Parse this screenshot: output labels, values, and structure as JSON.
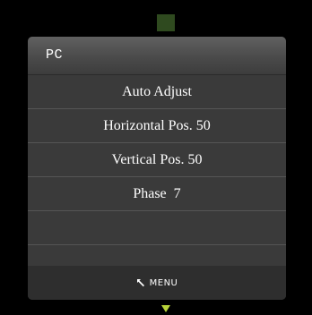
{
  "osd": {
    "title": "PC",
    "items": [
      {
        "label": "Auto Adjust"
      },
      {
        "label": "Horizontal Pos. 50"
      },
      {
        "label": "Vertical Pos. 50"
      },
      {
        "label": "Phase  7"
      },
      {
        "label": ""
      },
      {
        "label": ""
      }
    ],
    "footer": {
      "menu_label": "MENU",
      "icon": "return-arrow-icon"
    }
  },
  "indicators": {
    "top": "scroll-up-indicator",
    "bottom": "scroll-down-arrow-icon"
  },
  "colors": {
    "background": "#000000",
    "panel": "#3a3a3a",
    "header": "#555555",
    "footer": "#2e2e2e",
    "text": "#ffffff",
    "top_indicator": "#2f4a1f",
    "bottom_arrow": "#b8d43a"
  }
}
